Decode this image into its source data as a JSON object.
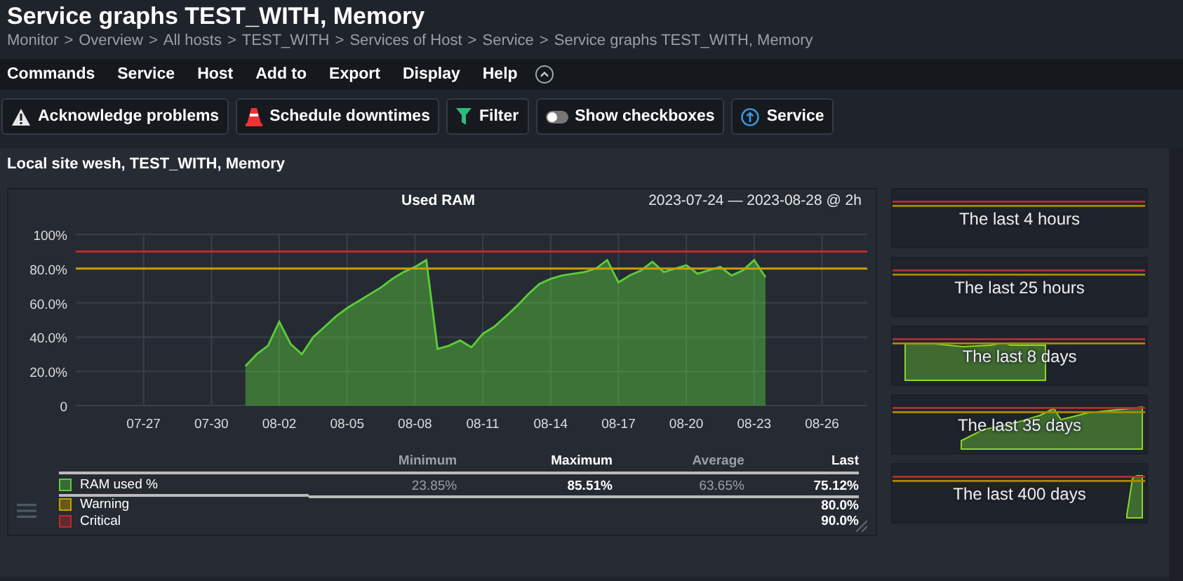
{
  "header": {
    "title": "Service graphs TEST_WITH, Memory",
    "breadcrumb": [
      "Monitor",
      "Overview",
      "All hosts",
      "TEST_WITH",
      "Services of Host",
      "Service",
      "Service graphs TEST_WITH, Memory"
    ],
    "breadcrumb_separator": ">"
  },
  "menu": [
    "Commands",
    "Service",
    "Host",
    "Add to",
    "Export",
    "Display",
    "Help"
  ],
  "toolbar": [
    {
      "kind": "warning",
      "label": "Acknowledge problems"
    },
    {
      "kind": "cone",
      "label": "Schedule downtimes"
    },
    {
      "kind": "filter",
      "label": "Filter"
    },
    {
      "kind": "toggle",
      "label": "Show checkboxes"
    },
    {
      "kind": "up",
      "label": "Service"
    }
  ],
  "panel": {
    "title": "Local site wesh, TEST_WITH, Memory",
    "graph": {
      "range": "2023-07-24 — 2023-08-28 @ 2h",
      "chart_data": {
        "type": "area",
        "title": "Used RAM",
        "ylim": [
          0,
          100
        ],
        "categories": [
          null,
          null,
          null,
          null,
          null,
          null,
          "07-27",
          null,
          null,
          null,
          null,
          null,
          "07-30",
          null,
          null,
          null,
          null,
          null,
          "08-02",
          null,
          null,
          null,
          null,
          null,
          "08-05",
          null,
          null,
          null,
          null,
          null,
          "08-08",
          null,
          null,
          null,
          null,
          null,
          "08-11",
          null,
          null,
          null,
          null,
          null,
          "08-14",
          null,
          null,
          null,
          null,
          null,
          "08-17",
          null,
          null,
          null,
          null,
          null,
          "08-20",
          null,
          null,
          null,
          null,
          null,
          "08-23",
          null,
          null,
          null,
          null,
          null,
          "08-26",
          null,
          null,
          null,
          null
        ],
        "yticks": [
          {
            "value": 0,
            "label": "0"
          },
          {
            "value": 20,
            "label": "20.0%"
          },
          {
            "value": 40,
            "label": "40.0%"
          },
          {
            "value": 60,
            "label": "60.0%"
          },
          {
            "value": 80,
            "label": "80.0%"
          },
          {
            "value": 100,
            "label": "100%"
          }
        ],
        "series": [
          {
            "name": "RAM used %",
            "color": "#5ccd3a",
            "values": [
              null,
              null,
              null,
              null,
              null,
              null,
              null,
              null,
              null,
              null,
              null,
              null,
              null,
              null,
              null,
              23,
              30,
              35,
              49,
              36,
              30,
              40,
              46,
              52,
              57,
              61,
              65,
              69,
              74,
              78,
              81,
              85,
              33,
              35,
              38,
              34,
              42,
              46,
              52,
              58,
              65,
              71,
              74,
              76,
              77,
              78,
              80,
              85,
              72,
              76,
              79,
              84,
              78,
              80,
              82,
              77,
              79,
              81,
              76,
              79,
              85,
              75,
              null,
              null,
              null,
              null,
              null,
              null,
              null,
              null,
              null
            ]
          },
          {
            "name": "Warning",
            "type": "line",
            "color": "#c8a000",
            "values": [
              80,
              80,
              80,
              80,
              80,
              80,
              80,
              80,
              80,
              80,
              80,
              80,
              80,
              80,
              80,
              80,
              80,
              80,
              80,
              80,
              80,
              80,
              80,
              80,
              80,
              80,
              80,
              80,
              80,
              80,
              80,
              80,
              80,
              80,
              80,
              80,
              80,
              80,
              80,
              80,
              80,
              80,
              80,
              80,
              80,
              80,
              80,
              80,
              80,
              80,
              80,
              80,
              80,
              80,
              80,
              80,
              80,
              80,
              80,
              80,
              80,
              80,
              80,
              80,
              80,
              80,
              80,
              80,
              80,
              80,
              80
            ]
          },
          {
            "name": "Critical",
            "type": "line",
            "color": "#c0282b",
            "values": [
              90,
              90,
              90,
              90,
              90,
              90,
              90,
              90,
              90,
              90,
              90,
              90,
              90,
              90,
              90,
              90,
              90,
              90,
              90,
              90,
              90,
              90,
              90,
              90,
              90,
              90,
              90,
              90,
              90,
              90,
              90,
              90,
              90,
              90,
              90,
              90,
              90,
              90,
              90,
              90,
              90,
              90,
              90,
              90,
              90,
              90,
              90,
              90,
              90,
              90,
              90,
              90,
              90,
              90,
              90,
              90,
              90,
              90,
              90,
              90,
              90,
              90,
              90,
              90,
              90,
              90,
              90,
              90,
              90,
              90,
              90
            ]
          }
        ],
        "grid": true
      },
      "legend": {
        "columns": [
          "Minimum",
          "Maximum",
          "Average",
          "Last"
        ],
        "series_stats": {
          "minimum": "23.85%",
          "maximum": "85.51%",
          "average": "63.65%",
          "last": "75.12%"
        },
        "rows": [
          {
            "last": "80.0%"
          },
          {
            "last": "90.0%"
          }
        ]
      }
    },
    "timeranges": [
      {
        "label": "The last 4 hours"
      },
      {
        "label": "The last 25 hours"
      },
      {
        "label": "The last 8 days"
      },
      {
        "label": "The last 35 days"
      },
      {
        "label": "The last 400 days"
      }
    ]
  }
}
